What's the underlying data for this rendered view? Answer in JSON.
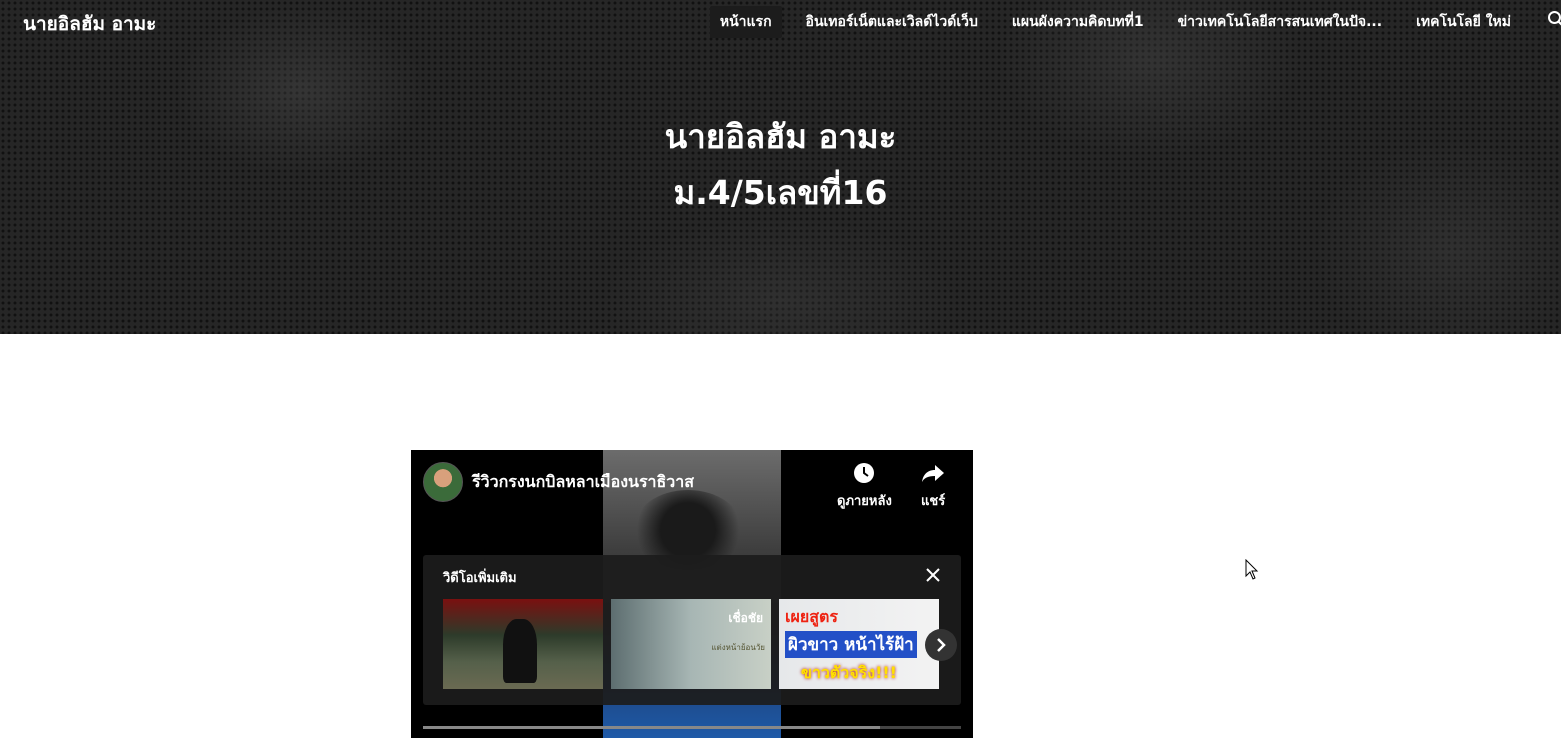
{
  "site": {
    "title": "นายอิลฮัม อามะ"
  },
  "nav": {
    "items": [
      {
        "label": "หน้าแรก",
        "active": true
      },
      {
        "label": "อินเทอร์เน็ตและเวิลด์ไวด์เว็บ",
        "active": false
      },
      {
        "label": "แผนผังความคิดบทที่1",
        "active": false
      },
      {
        "label": "ข่าวเทคโนโลยีสารสนเทศในปัจ...",
        "active": false
      },
      {
        "label": "เทคโนโลยี ใหม่",
        "active": false
      }
    ],
    "search_icon": "search-icon"
  },
  "hero": {
    "line1": "นายอิลฮัม อามะ",
    "line2": "ม.4/5เลขที่16"
  },
  "video": {
    "title": "รีวิวกรงนกบิลหลาเมืองนราธิวาส",
    "watch_later_label": "ดูภายหลัง",
    "share_label": "แชร์",
    "more_videos": {
      "title": "วิดีโอเพิ่มเติม",
      "thumb2_text": "เชื่อชัย",
      "thumb2_sub": "แต่งหน้าย้อนวัย",
      "thumb3_line1": "เผยสูตร",
      "thumb3_line2": "ผิวขาว หน้าไร้ฝ้า",
      "thumb3_line3": "ขาวตัวจริง!!!"
    },
    "progress_fraction": 0.85
  },
  "colors": {
    "hero_bg": "#262626",
    "nav_active_bg": "#1c1c1c"
  }
}
